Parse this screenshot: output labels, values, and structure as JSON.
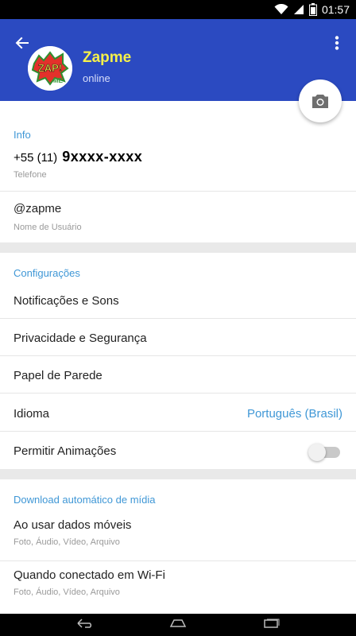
{
  "status_bar": {
    "time": "01:57"
  },
  "header": {
    "title": "Zapme",
    "status": "online",
    "avatar_logo_text": "ZAP! ME"
  },
  "info": {
    "section_title": "Info",
    "phone_prefix": "+55 (11)",
    "phone_number": "9xxxx-xxxx",
    "phone_label": "Telefone",
    "username": "@zapme",
    "username_label": "Nome de Usuário"
  },
  "settings": {
    "section_title": "Configurações",
    "notifications": "Notificações e Sons",
    "privacy": "Privacidade e Segurança",
    "wallpaper": "Papel de Parede",
    "language_label": "Idioma",
    "language_value": "Português (Brasil)",
    "animations": "Permitir Animações",
    "animations_enabled": false
  },
  "media": {
    "section_title": "Download automático de mídia",
    "mobile_label": "Ao usar dados móveis",
    "mobile_value": "Foto, Áudio, Vídeo, Arquivo",
    "wifi_label": "Quando conectado em Wi-Fi",
    "wifi_value": "Foto, Áudio, Vídeo, Arquivo"
  },
  "colors": {
    "header_bg": "#2b4ac1",
    "title_yellow": "#f5f04a",
    "accent_blue": "#3f97d6"
  },
  "icons": {
    "back": "arrow-back-icon",
    "menu": "more-vert-icon",
    "camera": "camera-icon",
    "wifi": "wifi-icon",
    "signal": "signal-icon",
    "battery": "battery-icon",
    "nav_back": "nav-back-icon",
    "nav_home": "nav-home-icon",
    "nav_recents": "nav-recents-icon"
  }
}
